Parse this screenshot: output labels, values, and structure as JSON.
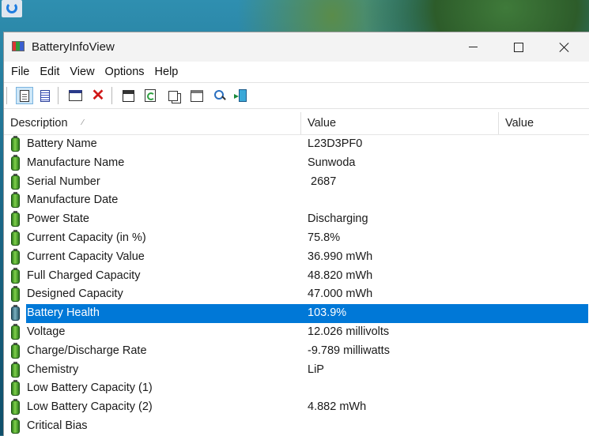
{
  "window": {
    "title": "BatteryInfoView",
    "controls": {
      "minimize": "minimize",
      "maximize": "maximize",
      "close": "close"
    }
  },
  "menu": [
    "File",
    "Edit",
    "View",
    "Options",
    "Help"
  ],
  "toolbar": {
    "icons": [
      "html-report-selected-icon",
      "html-report-all-icon",
      "window-icon",
      "delete-icon",
      "save-icon",
      "refresh-icon",
      "copy-icon",
      "properties-icon",
      "find-icon",
      "exit-icon"
    ]
  },
  "columns": [
    "Description",
    "Value",
    "Value"
  ],
  "rows": [
    {
      "name": "Battery Name",
      "value": "L23D3PF0"
    },
    {
      "name": "Manufacture Name",
      "value": "Sunwoda"
    },
    {
      "name": "Serial Number",
      "value": " 2687"
    },
    {
      "name": "Manufacture Date",
      "value": ""
    },
    {
      "name": "Power State",
      "value": "Discharging"
    },
    {
      "name": "Current Capacity (in %)",
      "value": "75.8%"
    },
    {
      "name": "Current Capacity Value",
      "value": "36.990 mWh"
    },
    {
      "name": "Full Charged Capacity",
      "value": "48.820 mWh"
    },
    {
      "name": "Designed Capacity",
      "value": "47.000 mWh"
    },
    {
      "name": "Battery Health",
      "value": "103.9%"
    },
    {
      "name": "Voltage",
      "value": "12.026 millivolts"
    },
    {
      "name": "Charge/Discharge Rate",
      "value": "-9.789 milliwatts"
    },
    {
      "name": "Chemistry",
      "value": "LiP"
    },
    {
      "name": "Low Battery Capacity (1)",
      "value": ""
    },
    {
      "name": "Low Battery Capacity (2)",
      "value": "4.882 mWh"
    },
    {
      "name": "Critical Bias",
      "value": ""
    }
  ],
  "selected_row": "Battery Health",
  "colors": {
    "selection": "#0078d7",
    "titlebar": "#f3f3f3"
  }
}
